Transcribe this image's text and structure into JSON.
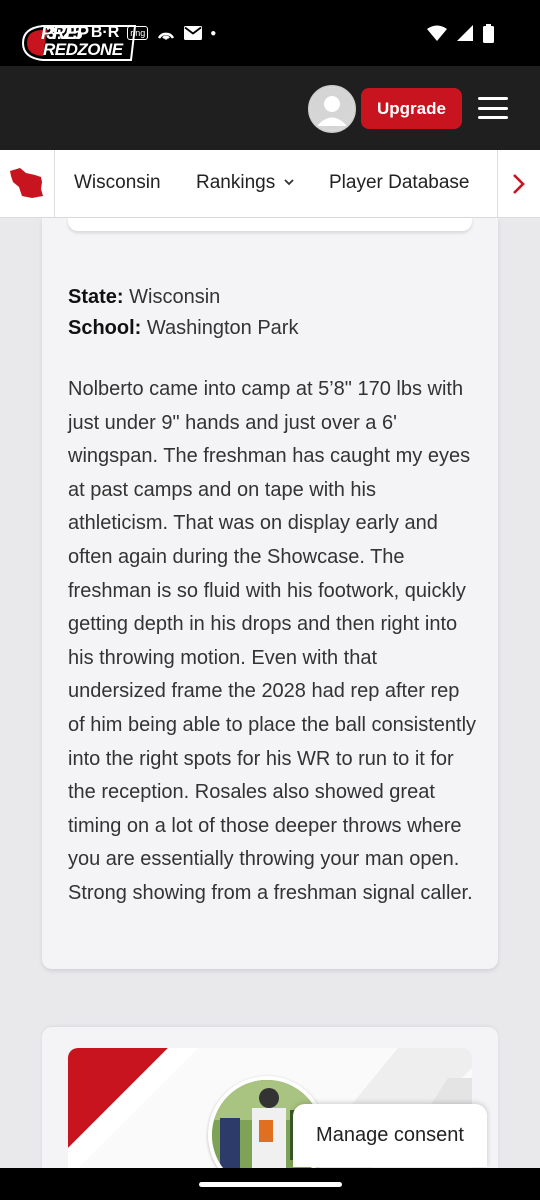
{
  "status_bar": {
    "time": "3:25",
    "app_icons": [
      "B·R",
      "ring"
    ]
  },
  "header": {
    "logo_line1": "PREP",
    "logo_line2": "REDZONE",
    "upgrade_label": "Upgrade",
    "accent_color": "#c8141f"
  },
  "subnav": {
    "items": [
      {
        "label": "Wisconsin"
      },
      {
        "label": "Rankings"
      },
      {
        "label": "Player Database"
      }
    ]
  },
  "article": {
    "state_label": "State:",
    "state_value": "Wisconsin",
    "school_label": "School:",
    "school_value": "Washington Park",
    "body": "Nolberto came into camp at 5’8\" 170 lbs with just under 9\" hands and just over a 6' wingspan. The freshman has caught my eyes at past camps and on tape with his athleticism. That was on display early and often again during the Showcase. The freshman is so fluid with his footwork, quickly getting depth in his drops and then right into his throwing motion. Even with that undersized frame the 2028 had rep after rep of him being able to place the ball consistently into the right spots for his WR to run to it for the reception. Rosales also showed great timing on a lot of those deeper throws where you are essentially throwing your man open. Strong showing from a freshman signal caller."
  },
  "consent": {
    "label": "Manage consent"
  }
}
